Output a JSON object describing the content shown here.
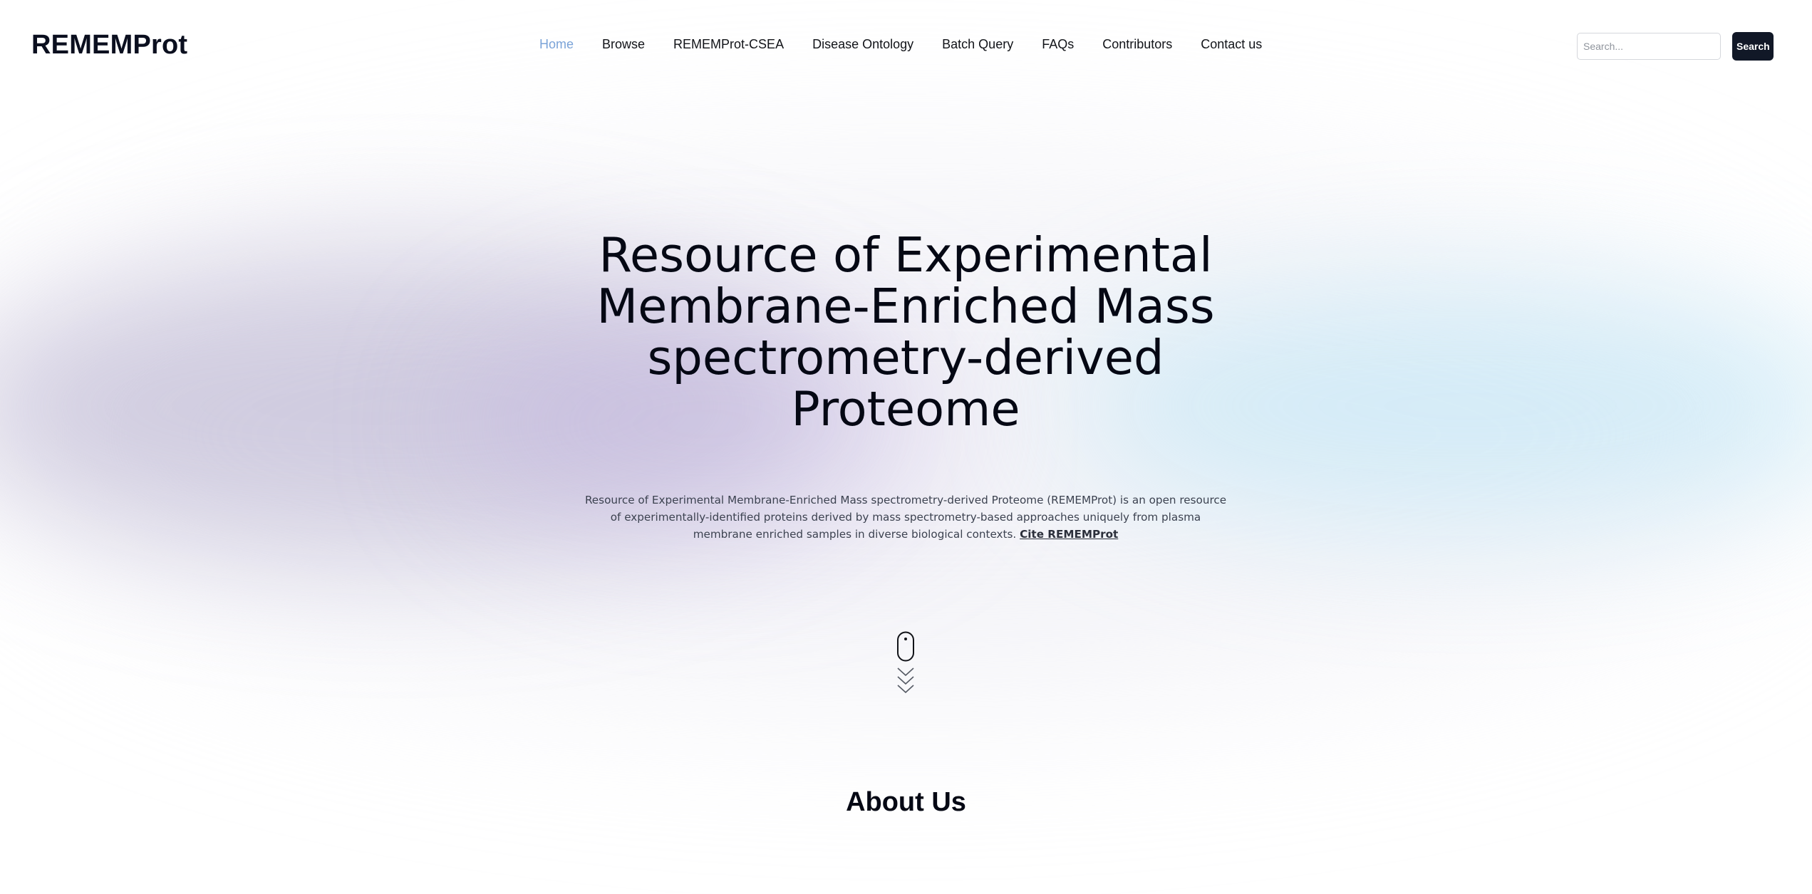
{
  "header": {
    "brand": "REMEMProt",
    "nav": [
      {
        "label": "Home",
        "active": true
      },
      {
        "label": "Browse",
        "active": false
      },
      {
        "label": "REMEMProt-CSEA",
        "active": false
      },
      {
        "label": "Disease Ontology",
        "active": false
      },
      {
        "label": "Batch Query",
        "active": false
      },
      {
        "label": "FAQs",
        "active": false
      },
      {
        "label": "Contributors",
        "active": false
      },
      {
        "label": "Contact us",
        "active": false
      }
    ],
    "search": {
      "placeholder": "Search...",
      "value": "",
      "button_label": "Search"
    }
  },
  "hero": {
    "title": "Resource of Experimental Membrane-Enriched Mass spectrometry-derived Proteome",
    "description": "Resource of Experimental Membrane-Enriched Mass spectrometry-derived Proteome (REMEMProt) is an open resource of experimentally-identified proteins derived by mass spectrometry-based approaches uniquely from plasma membrane enriched samples in diverse biological contexts.",
    "cite_label": "Cite REMEMProt",
    "scroll_icon": "mouse-scroll-down-icon"
  },
  "about": {
    "heading": "About Us"
  },
  "colors": {
    "active_nav": "#7aa3d8",
    "search_button_bg": "#111827",
    "text_primary": "#050814"
  }
}
